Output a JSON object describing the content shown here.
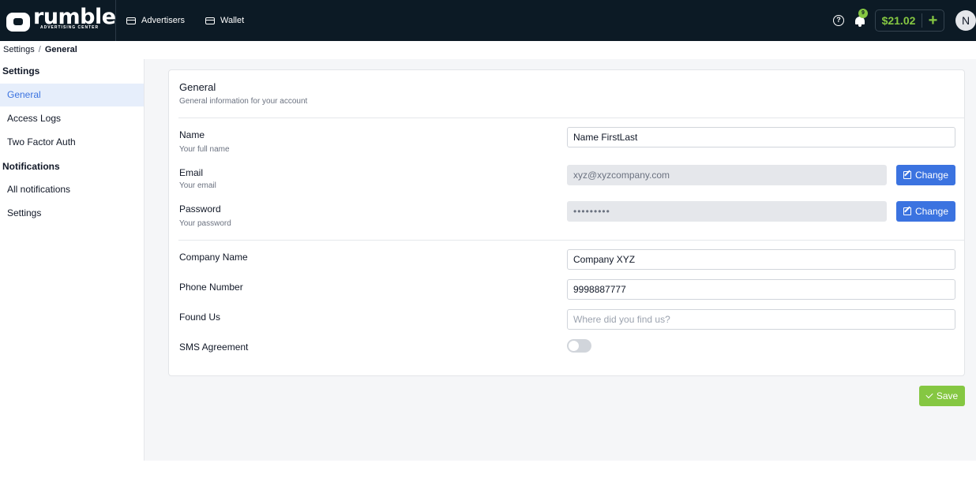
{
  "brand": {
    "name": "rumble",
    "tagline": "ADVERTISING CENTER"
  },
  "nav": {
    "advertisers": "Advertisers",
    "wallet": "Wallet"
  },
  "header": {
    "help_glyph": "?",
    "notification_count": "9",
    "balance": "$21.02",
    "add_funds": "+",
    "avatar_initial": "N"
  },
  "breadcrumb": {
    "root": "Settings",
    "separator": "/",
    "current": "General"
  },
  "sidebar": {
    "settings_heading": "Settings",
    "settings_items": [
      {
        "label": "General"
      },
      {
        "label": "Access Logs"
      },
      {
        "label": "Two Factor Auth"
      }
    ],
    "notifications_heading": "Notifications",
    "notifications_items": [
      {
        "label": "All notifications"
      },
      {
        "label": "Settings"
      }
    ]
  },
  "panel": {
    "title": "General",
    "subtitle": "General information for your account",
    "name": {
      "label": "Name",
      "hint": "Your full name",
      "value": "Name FirstLast"
    },
    "email": {
      "label": "Email",
      "hint": "Your email",
      "value": "xyz@xyzcompany.com",
      "button": "Change"
    },
    "password": {
      "label": "Password",
      "hint": "Your password",
      "value": "•••••••••",
      "button": "Change"
    },
    "company": {
      "label": "Company Name",
      "value": "Company XYZ"
    },
    "phone": {
      "label": "Phone Number",
      "value": "9998887777"
    },
    "found_us": {
      "label": "Found Us",
      "placeholder": "Where did you find us?",
      "value": ""
    },
    "sms": {
      "label": "SMS Agreement",
      "enabled": false
    }
  },
  "actions": {
    "save": "Save"
  },
  "colors": {
    "topbar": "#0c1a25",
    "accent_green": "#85c742",
    "primary_blue": "#3b73e0",
    "active_nav_bg": "#e6eefb"
  },
  "icons": [
    "logo-icon",
    "card-icon",
    "help-icon",
    "bell-icon",
    "plus-icon",
    "edit-icon",
    "check-icon"
  ]
}
